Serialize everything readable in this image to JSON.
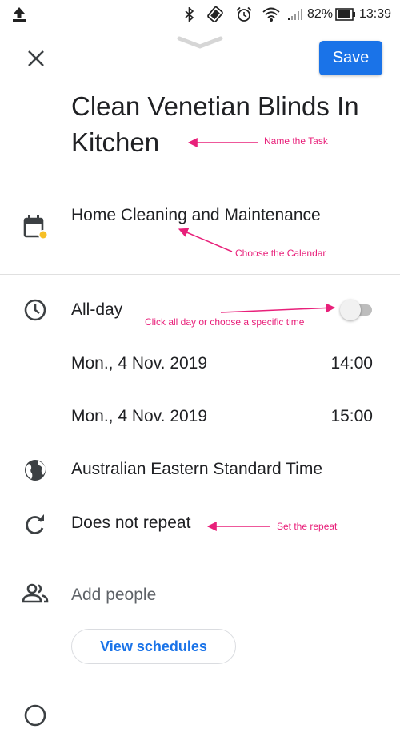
{
  "status_bar": {
    "battery": "82%",
    "time": "13:39"
  },
  "header": {
    "save_label": "Save"
  },
  "task": {
    "title_line1": "Clean Venetian Blinds In",
    "title_line2": "Kitchen"
  },
  "calendar": {
    "name": "Home Cleaning and Maintenance",
    "dot_color": "#f6bf26"
  },
  "allday": {
    "label": "All-day",
    "enabled": false
  },
  "start": {
    "date": "Mon., 4 Nov. 2019",
    "time": "14:00"
  },
  "end": {
    "date": "Mon., 4 Nov. 2019",
    "time": "15:00"
  },
  "timezone": {
    "label": "Australian Eastern Standard Time"
  },
  "repeat": {
    "label": "Does not repeat"
  },
  "people": {
    "label": "Add people",
    "view_schedules": "View schedules"
  },
  "annotations": {
    "name_task": "Name the Task",
    "choose_calendar": "Choose the Calendar",
    "all_day": "Click all day or choose a specific time",
    "set_repeat": "Set the repeat"
  },
  "colors": {
    "accent": "#1a73e8",
    "annotation": "#e8207a"
  }
}
